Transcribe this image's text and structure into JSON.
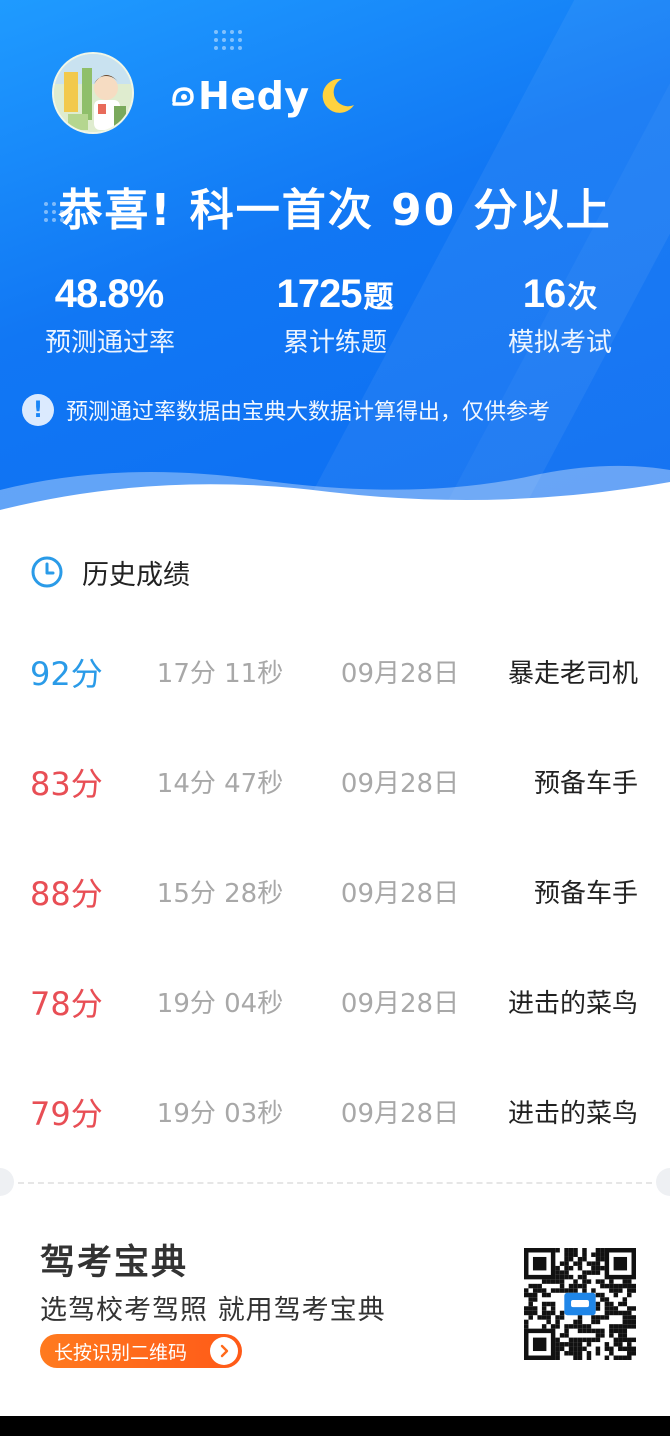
{
  "profile": {
    "username": "Hedy",
    "avatar_icon": "avatar-illustration",
    "badge_icon": "moon-emoji"
  },
  "headline": "恭喜! 科一首次 90 分以上",
  "stats": [
    {
      "value": "48.8%",
      "unit": "",
      "label": "预测通过率"
    },
    {
      "value": "1725",
      "unit": "题",
      "label": "累计练题"
    },
    {
      "value": "16",
      "unit": "次",
      "label": "模拟考试"
    }
  ],
  "notice": {
    "icon": "exclamation-icon",
    "text": "预测通过率数据由宝典大数据计算得出，仅供参考"
  },
  "history": {
    "icon": "clock-icon",
    "title": "历史成绩",
    "rows": [
      {
        "score": "92分",
        "duration": "17分 11秒",
        "date": "09月28日",
        "rank": "暴走老司机",
        "color": "#2a9be8"
      },
      {
        "score": "83分",
        "duration": "14分 47秒",
        "date": "09月28日",
        "rank": "预备车手",
        "color": "#e84e55"
      },
      {
        "score": "88分",
        "duration": "15分 28秒",
        "date": "09月28日",
        "rank": "预备车手",
        "color": "#e84e55"
      },
      {
        "score": "78分",
        "duration": "19分 04秒",
        "date": "09月28日",
        "rank": "进击的菜鸟",
        "color": "#e84e55"
      },
      {
        "score": "79分",
        "duration": "19分 03秒",
        "date": "09月28日",
        "rank": "进击的菜鸟",
        "color": "#e84e55"
      }
    ]
  },
  "footer": {
    "title": "驾考宝典",
    "subtitle": "选驾校考驾照 就用驾考宝典",
    "pill_label": "长按识别二维码",
    "pill_icon": "chevron-right-icon",
    "qr_icon": "qr-code"
  },
  "colors": {
    "hero_blue": "#1177f4",
    "pass_blue": "#2a9be8",
    "fail_red": "#e84e55",
    "cta_orange": "#ff6a1c"
  }
}
